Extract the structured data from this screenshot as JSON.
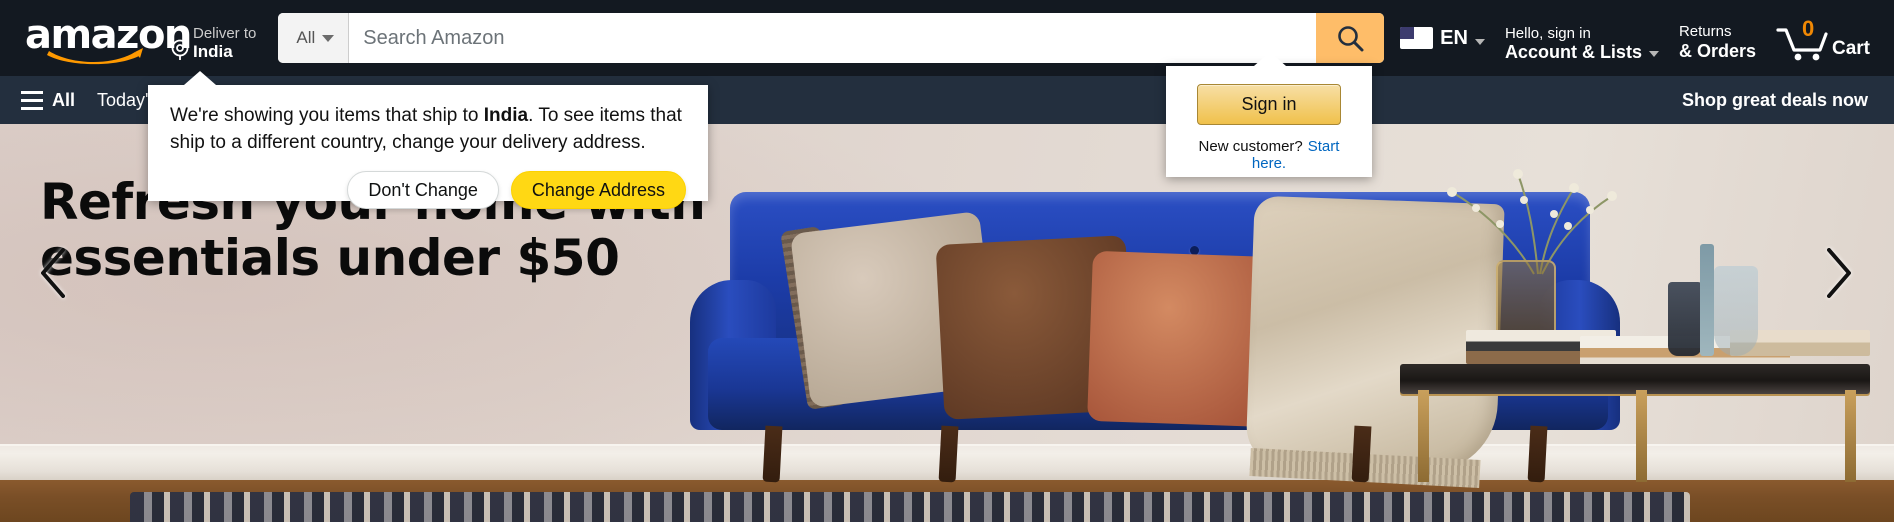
{
  "site": {
    "logo_text": "amazon"
  },
  "topnav": {
    "deliver": {
      "line1": "Deliver to",
      "line2": "India",
      "icon": "location-pin-icon"
    },
    "search": {
      "category_label": "All",
      "placeholder": "Search Amazon",
      "value": "",
      "button_icon": "search-icon"
    },
    "language": {
      "code": "EN",
      "flag": "us-flag-icon"
    },
    "account": {
      "line1": "Hello, sign in",
      "line2": "Account & Lists"
    },
    "returns": {
      "line1": "Returns",
      "line2": "& Orders"
    },
    "cart": {
      "count": "0",
      "label": "Cart",
      "icon": "shopping-cart-icon"
    }
  },
  "subnav": {
    "all_label": "All",
    "items": [
      {
        "label": "Today's Deals"
      }
    ],
    "promo": "Shop great deals now"
  },
  "hero": {
    "headline_line1": "Refresh your home with",
    "headline_line2": "essentials under $50",
    "prev_icon": "chevron-left-icon",
    "next_icon": "chevron-right-icon"
  },
  "address_popover": {
    "text_before": "We're showing you items that ship to ",
    "country": "India",
    "text_after": ". To see items that ship to a different country, change your delivery address.",
    "dont_change_label": "Don't Change",
    "change_address_label": "Change Address"
  },
  "signin_popover": {
    "sign_in_label": "Sign in",
    "new_customer_label": "New customer?",
    "start_here_label": "Start here."
  },
  "colors": {
    "nav_dark": "#131921",
    "subnav_dark": "#232F3E",
    "amazon_orange": "#FF9900",
    "search_button": "#FEBD69",
    "yellow_button": "#FFD814",
    "link_blue": "#0066C0",
    "cart_badge": "#F08804",
    "hero_wall": "#DDD1CB",
    "sofa_blue": "#1C3CA8"
  }
}
